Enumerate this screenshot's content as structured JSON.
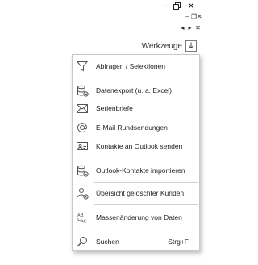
{
  "window_controls": {
    "minimize": "—",
    "close": "✕"
  },
  "mdi_controls": {
    "minimize": "–",
    "restore": "❐",
    "close": "✕"
  },
  "nav_controls": {
    "prev": "◂",
    "next": "▸",
    "close": "✕"
  },
  "toolbar": {
    "werkzeuge_label": "Werkzeuge"
  },
  "menu": {
    "items": [
      {
        "label": "Abfragen / Selektionen",
        "icon": "filter-icon"
      },
      {
        "label": "Datenexport (u. a. Excel)",
        "icon": "database-export-icon"
      },
      {
        "label": "Serienbriefe",
        "icon": "envelope-icon"
      },
      {
        "label": "E-Mail Rundsendungen",
        "icon": "at-sign-icon"
      },
      {
        "label": "Kontakte an Outlook senden",
        "icon": "contact-card-icon"
      },
      {
        "label": "Outlook-Kontakte importieren",
        "icon": "database-import-icon"
      },
      {
        "label": "Übersicht gelöschter Kunden",
        "icon": "deleted-users-icon"
      },
      {
        "label": "Massenänderung von Daten",
        "icon": "replace-text-icon"
      },
      {
        "label": "Suchen",
        "shortcut": "Strg+F",
        "icon": "search-icon"
      }
    ]
  }
}
